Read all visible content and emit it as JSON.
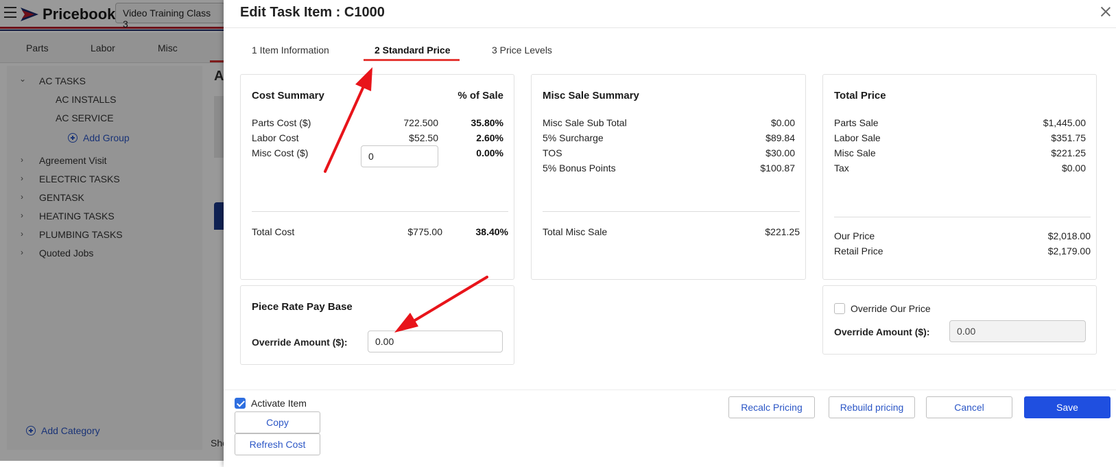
{
  "app": {
    "brand": "Pricebook",
    "company": "Video Training Class 3",
    "category_tabs": [
      "Parts",
      "Labor",
      "Misc"
    ],
    "tree": {
      "root": "AC TASKS",
      "children": [
        "AC INSTALLS",
        "AC SERVICE"
      ],
      "add_group": "Add Group",
      "categories": [
        "Agreement Visit",
        "ELECTRIC TASKS",
        "GENTASK",
        "HEATING TASKS",
        "PLUMBING TASKS",
        "Quoted Jobs"
      ],
      "add_category": "Add Category"
    },
    "partial_heading": "A",
    "partial_footer": "Sho"
  },
  "modal": {
    "title": "Edit Task Item : C1000",
    "tabs": [
      {
        "label": "1 Item Information",
        "active": false
      },
      {
        "label": "2 Standard Price",
        "active": true
      },
      {
        "label": "3 Price Levels",
        "active": false
      }
    ],
    "cost_summary": {
      "title": "Cost Summary",
      "pct_header": "% of Sale",
      "parts_label": "Parts Cost ($)",
      "parts_value": "722.500",
      "parts_pct": "35.80%",
      "labor_label": "Labor Cost",
      "labor_value": "$52.50",
      "labor_pct": "2.60%",
      "misc_label": "Misc Cost ($)",
      "misc_input": "0",
      "misc_pct": "0.00%",
      "total_label": "Total Cost",
      "total_value": "$775.00",
      "total_pct": "38.40%"
    },
    "misc_sale_summary": {
      "title": "Misc Sale Summary",
      "rows": [
        {
          "label": "Misc Sale Sub Total",
          "value": "$0.00"
        },
        {
          "label": "5% Surcharge",
          "value": "$89.84"
        },
        {
          "label": "TOS",
          "value": "$30.00"
        },
        {
          "label": "5% Bonus Points",
          "value": "$100.87"
        }
      ],
      "total_label": "Total Misc Sale",
      "total_value": "$221.25"
    },
    "total_price": {
      "title": "Total Price",
      "rows": [
        {
          "label": "Parts Sale",
          "value": "$1,445.00"
        },
        {
          "label": "Labor Sale",
          "value": "$351.75"
        },
        {
          "label": "Misc Sale",
          "value": "$221.25"
        },
        {
          "label": "Tax",
          "value": "$0.00"
        }
      ],
      "our_price_label": "Our Price",
      "our_price_value": "$2,018.00",
      "retail_price_label": "Retail Price",
      "retail_price_value": "$2,179.00"
    },
    "piece_rate": {
      "title": "Piece Rate Pay Base",
      "override_label": "Override Amount ($):",
      "override_value": "0.00"
    },
    "override_our_price": {
      "checkbox_label": "Override Our Price",
      "checked": false,
      "override_label": "Override Amount ($):",
      "override_value": "0.00"
    },
    "footer": {
      "activate_label": "Activate Item",
      "activate_checked": true,
      "copy": "Copy",
      "refresh_cost": "Refresh Cost",
      "recalc": "Recalc Pricing",
      "rebuild": "Rebuild pricing",
      "cancel": "Cancel",
      "save": "Save"
    }
  },
  "colors": {
    "primary": "#1f4fe0",
    "link": "#2b56c6",
    "tab_underline": "#e53935",
    "annotation_arrow": "#e8141a"
  },
  "icons": [
    "menu-icon",
    "pricebook-logo-icon",
    "close-icon",
    "add-circle-icon",
    "chevron-right-icon",
    "chevron-down-icon",
    "check-icon"
  ]
}
